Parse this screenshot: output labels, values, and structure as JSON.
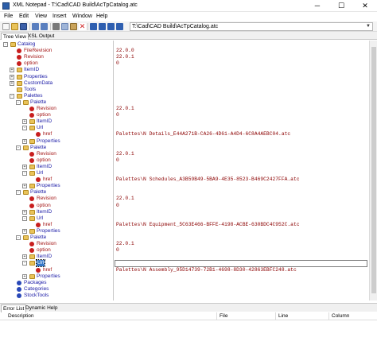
{
  "window": {
    "title": "XML Notepad - T:\\Cad\\CAD Build\\AcTpCatalog.atc",
    "minimize": "─",
    "maximize": "☐",
    "close": "✕"
  },
  "menu": [
    "File",
    "Edit",
    "View",
    "Insert",
    "Window",
    "Help"
  ],
  "toolbar": {
    "path": "T:\\Cad\\CAD Build\\AcTpCatalog.atc",
    "buttons": [
      "new-icon",
      "open-icon",
      "save-icon",
      "undo-icon",
      "redo-icon",
      "cut-icon",
      "copy-icon",
      "paste-icon",
      "delete-icon",
      "nudge-up-icon",
      "nudge-down-icon",
      "nudge-left-icon",
      "nudge-right-icon"
    ]
  },
  "tabs": {
    "tree": "Tree View",
    "xsl": "XSL Output"
  },
  "tree": [
    {
      "label": "Catalog",
      "type": "folder",
      "exp": "-",
      "value": ""
    },
    {
      "label": "FileRevision",
      "type": "red",
      "exp": "",
      "value": "22.0.0"
    },
    {
      "label": "Revision",
      "type": "red",
      "exp": "",
      "value": "22.0.1"
    },
    {
      "label": "option",
      "type": "red",
      "exp": "",
      "value": "0"
    },
    {
      "label": "ItemID",
      "type": "folder",
      "exp": "+",
      "value": ""
    },
    {
      "label": "Properties",
      "type": "folder",
      "exp": "+",
      "value": ""
    },
    {
      "label": "CustomData",
      "type": "folder",
      "exp": "+",
      "value": ""
    },
    {
      "label": "Tools",
      "type": "folder",
      "exp": "",
      "value": ""
    },
    {
      "label": "Palettes",
      "type": "folder",
      "exp": "-",
      "value": ""
    },
    {
      "label": "Palette",
      "type": "folder",
      "exp": "-",
      "value": ""
    },
    {
      "label": "Revision",
      "type": "red",
      "exp": "",
      "value": "22.0.1"
    },
    {
      "label": "option",
      "type": "red",
      "exp": "",
      "value": "0"
    },
    {
      "label": "ItemID",
      "type": "folder",
      "exp": "+",
      "value": ""
    },
    {
      "label": "Url",
      "type": "folder",
      "exp": "-",
      "value": ""
    },
    {
      "label": "href",
      "type": "red",
      "exp": "",
      "value": "Palettes\\N Details_E44A271B-CA26-4D61-A4D4-6C8A4AEBC04.atc"
    },
    {
      "label": "Properties",
      "type": "folder",
      "exp": "+",
      "value": ""
    },
    {
      "label": "Palette",
      "type": "folder",
      "exp": "-",
      "value": ""
    },
    {
      "label": "Revision",
      "type": "red",
      "exp": "",
      "value": "22.0.1"
    },
    {
      "label": "option",
      "type": "red",
      "exp": "",
      "value": "0"
    },
    {
      "label": "ItemID",
      "type": "folder",
      "exp": "+",
      "value": ""
    },
    {
      "label": "Url",
      "type": "folder",
      "exp": "-",
      "value": ""
    },
    {
      "label": "href",
      "type": "red",
      "exp": "",
      "value": "Palettes\\N Schedules_A3B59B49-5BA9-4E35-8523-B469C2427FFA.atc"
    },
    {
      "label": "Properties",
      "type": "folder",
      "exp": "+",
      "value": ""
    },
    {
      "label": "Palette",
      "type": "folder",
      "exp": "-",
      "value": ""
    },
    {
      "label": "Revision",
      "type": "red",
      "exp": "",
      "value": "22.0.1"
    },
    {
      "label": "option",
      "type": "red",
      "exp": "",
      "value": "0"
    },
    {
      "label": "ItemID",
      "type": "folder",
      "exp": "+",
      "value": ""
    },
    {
      "label": "Url",
      "type": "folder",
      "exp": "-",
      "value": ""
    },
    {
      "label": "href",
      "type": "red",
      "exp": "",
      "value": "Palettes\\N Equipment_5C63E466-BFFE-4198-ACBE-630BDC4C952C.atc"
    },
    {
      "label": "Properties",
      "type": "folder",
      "exp": "+",
      "value": ""
    },
    {
      "label": "Palette",
      "type": "folder",
      "exp": "-",
      "value": ""
    },
    {
      "label": "Revision",
      "type": "red",
      "exp": "",
      "value": "22.0.1"
    },
    {
      "label": "option",
      "type": "red",
      "exp": "",
      "value": "0"
    },
    {
      "label": "ItemID",
      "type": "folder",
      "exp": "+",
      "value": ""
    },
    {
      "label": "Url",
      "type": "folder",
      "exp": "-",
      "value": "",
      "selected": true
    },
    {
      "label": "href",
      "type": "red",
      "exp": "",
      "value": "Palettes\\N Assembly_95D14739-72B1-4698-8D30-42863EBFC248.atc"
    },
    {
      "label": "Properties",
      "type": "folder",
      "exp": "+",
      "value": ""
    },
    {
      "label": "Packages",
      "type": "blue",
      "exp": "",
      "value": ""
    },
    {
      "label": "Categories",
      "type": "blue",
      "exp": "",
      "value": ""
    },
    {
      "label": "StockTools",
      "type": "blue",
      "exp": "",
      "value": ""
    }
  ],
  "bottom_tabs": {
    "errors": "Error List",
    "help": "Dynamic Help"
  },
  "error_columns": {
    "description": "Description",
    "file": "File",
    "line": "Line",
    "column": "Column"
  },
  "colors": {
    "accent": "#3478c8",
    "element_label": "#1a1aa6",
    "attribute_label": "#a31515",
    "value_text": "#8b0000"
  }
}
